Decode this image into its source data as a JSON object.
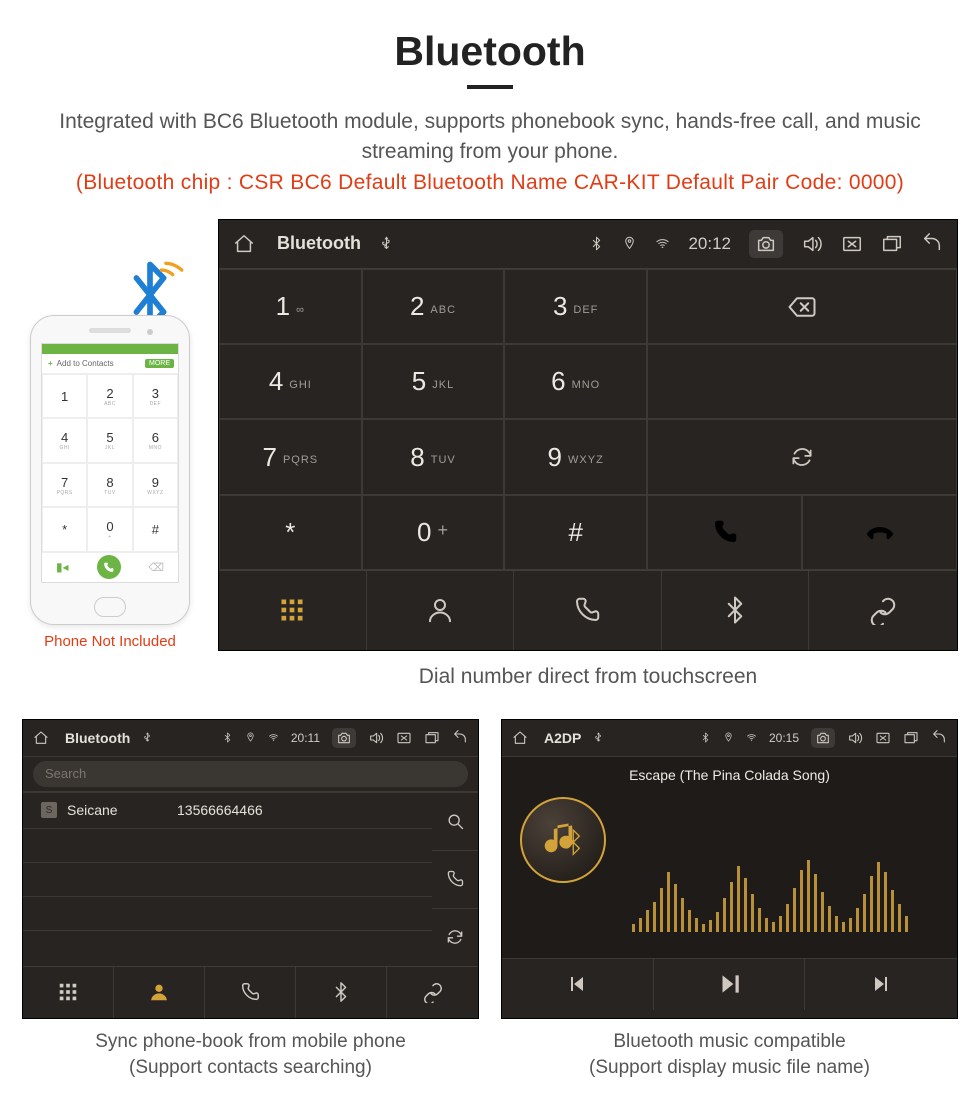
{
  "header": {
    "title": "Bluetooth",
    "desc": "Integrated with BC6 Bluetooth module, supports phonebook sync, hands-free call, and music streaming from your phone.",
    "specs": "(Bluetooth chip : CSR BC6     Default Bluetooth Name CAR-KIT     Default Pair Code: 0000)"
  },
  "phone_mock": {
    "add_label": "Add to Contacts",
    "more_label": "MORE",
    "keys": [
      {
        "n": "1",
        "l": ""
      },
      {
        "n": "2",
        "l": "ABC"
      },
      {
        "n": "3",
        "l": "DEF"
      },
      {
        "n": "4",
        "l": "GHI"
      },
      {
        "n": "5",
        "l": "JKL"
      },
      {
        "n": "6",
        "l": "MNO"
      },
      {
        "n": "7",
        "l": "PQRS"
      },
      {
        "n": "8",
        "l": "TUV"
      },
      {
        "n": "9",
        "l": "WXYZ"
      },
      {
        "n": "*",
        "l": ""
      },
      {
        "n": "0",
        "l": "+"
      },
      {
        "n": "#",
        "l": ""
      }
    ],
    "note": "Phone Not Included"
  },
  "dialer": {
    "status": {
      "title": "Bluetooth",
      "time": "20:12"
    },
    "keys": [
      {
        "n": "1",
        "l": "∞"
      },
      {
        "n": "2",
        "l": "ABC"
      },
      {
        "n": "3",
        "l": "DEF"
      },
      {
        "n": "4",
        "l": "GHI"
      },
      {
        "n": "5",
        "l": "JKL"
      },
      {
        "n": "6",
        "l": "MNO"
      },
      {
        "n": "7",
        "l": "PQRS"
      },
      {
        "n": "8",
        "l": "TUV"
      },
      {
        "n": "9",
        "l": "WXYZ"
      },
      {
        "n": "*",
        "l": ""
      },
      {
        "n": "0",
        "l": "+"
      },
      {
        "n": "#",
        "l": ""
      }
    ],
    "zero_plus": "+",
    "caption": "Dial number direct from touchscreen"
  },
  "phonebook": {
    "status": {
      "title": "Bluetooth",
      "time": "20:11"
    },
    "search_placeholder": "Search",
    "contact": {
      "badge": "S",
      "name": "Seicane",
      "number": "13566664466"
    },
    "caption_l1": "Sync phone-book from mobile phone",
    "caption_l2": "(Support contacts searching)"
  },
  "music": {
    "status": {
      "title": "A2DP",
      "time": "20:15"
    },
    "track": "Escape (The Pina Colada Song)",
    "caption_l1": "Bluetooth music compatible",
    "caption_l2": "(Support display music file name)"
  }
}
